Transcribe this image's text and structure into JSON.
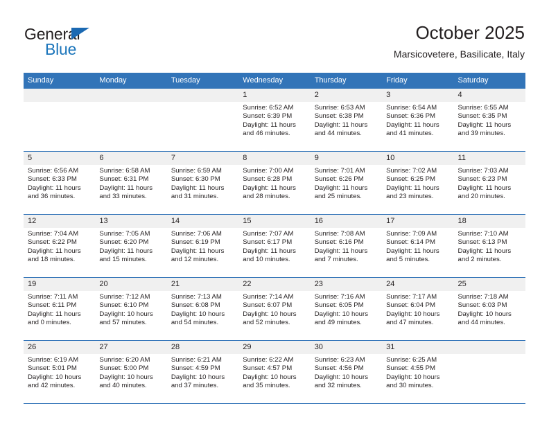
{
  "brand": {
    "name_top": "General",
    "name_bottom": "Blue",
    "accent_color": "#1b75bb",
    "triangle_color": "#1b69b2"
  },
  "header": {
    "title": "October 2025",
    "subtitle": "Marsicovetere, Basilicate, Italy"
  },
  "theme": {
    "header_row_bg": "#3274b8",
    "header_row_text": "#ffffff",
    "daynum_bg": "#f0f0f0",
    "body_text": "#231f20",
    "page_bg": "#ffffff"
  },
  "weekday_headers": [
    "Sunday",
    "Monday",
    "Tuesday",
    "Wednesday",
    "Thursday",
    "Friday",
    "Saturday"
  ],
  "labels": {
    "sunrise_prefix": "Sunrise:",
    "sunset_prefix": "Sunset:",
    "daylight_prefix": "Daylight:"
  },
  "weeks": [
    [
      {
        "day": "",
        "sunrise": "",
        "sunset": "",
        "daylight_line1": "",
        "daylight_line2": "",
        "empty": true
      },
      {
        "day": "",
        "sunrise": "",
        "sunset": "",
        "daylight_line1": "",
        "daylight_line2": "",
        "empty": true
      },
      {
        "day": "",
        "sunrise": "",
        "sunset": "",
        "daylight_line1": "",
        "daylight_line2": "",
        "empty": true
      },
      {
        "day": "1",
        "sunrise": "Sunrise: 6:52 AM",
        "sunset": "Sunset: 6:39 PM",
        "daylight_line1": "Daylight: 11 hours",
        "daylight_line2": "and 46 minutes."
      },
      {
        "day": "2",
        "sunrise": "Sunrise: 6:53 AM",
        "sunset": "Sunset: 6:38 PM",
        "daylight_line1": "Daylight: 11 hours",
        "daylight_line2": "and 44 minutes."
      },
      {
        "day": "3",
        "sunrise": "Sunrise: 6:54 AM",
        "sunset": "Sunset: 6:36 PM",
        "daylight_line1": "Daylight: 11 hours",
        "daylight_line2": "and 41 minutes."
      },
      {
        "day": "4",
        "sunrise": "Sunrise: 6:55 AM",
        "sunset": "Sunset: 6:35 PM",
        "daylight_line1": "Daylight: 11 hours",
        "daylight_line2": "and 39 minutes."
      }
    ],
    [
      {
        "day": "5",
        "sunrise": "Sunrise: 6:56 AM",
        "sunset": "Sunset: 6:33 PM",
        "daylight_line1": "Daylight: 11 hours",
        "daylight_line2": "and 36 minutes."
      },
      {
        "day": "6",
        "sunrise": "Sunrise: 6:58 AM",
        "sunset": "Sunset: 6:31 PM",
        "daylight_line1": "Daylight: 11 hours",
        "daylight_line2": "and 33 minutes."
      },
      {
        "day": "7",
        "sunrise": "Sunrise: 6:59 AM",
        "sunset": "Sunset: 6:30 PM",
        "daylight_line1": "Daylight: 11 hours",
        "daylight_line2": "and 31 minutes."
      },
      {
        "day": "8",
        "sunrise": "Sunrise: 7:00 AM",
        "sunset": "Sunset: 6:28 PM",
        "daylight_line1": "Daylight: 11 hours",
        "daylight_line2": "and 28 minutes."
      },
      {
        "day": "9",
        "sunrise": "Sunrise: 7:01 AM",
        "sunset": "Sunset: 6:26 PM",
        "daylight_line1": "Daylight: 11 hours",
        "daylight_line2": "and 25 minutes."
      },
      {
        "day": "10",
        "sunrise": "Sunrise: 7:02 AM",
        "sunset": "Sunset: 6:25 PM",
        "daylight_line1": "Daylight: 11 hours",
        "daylight_line2": "and 23 minutes."
      },
      {
        "day": "11",
        "sunrise": "Sunrise: 7:03 AM",
        "sunset": "Sunset: 6:23 PM",
        "daylight_line1": "Daylight: 11 hours",
        "daylight_line2": "and 20 minutes."
      }
    ],
    [
      {
        "day": "12",
        "sunrise": "Sunrise: 7:04 AM",
        "sunset": "Sunset: 6:22 PM",
        "daylight_line1": "Daylight: 11 hours",
        "daylight_line2": "and 18 minutes."
      },
      {
        "day": "13",
        "sunrise": "Sunrise: 7:05 AM",
        "sunset": "Sunset: 6:20 PM",
        "daylight_line1": "Daylight: 11 hours",
        "daylight_line2": "and 15 minutes."
      },
      {
        "day": "14",
        "sunrise": "Sunrise: 7:06 AM",
        "sunset": "Sunset: 6:19 PM",
        "daylight_line1": "Daylight: 11 hours",
        "daylight_line2": "and 12 minutes."
      },
      {
        "day": "15",
        "sunrise": "Sunrise: 7:07 AM",
        "sunset": "Sunset: 6:17 PM",
        "daylight_line1": "Daylight: 11 hours",
        "daylight_line2": "and 10 minutes."
      },
      {
        "day": "16",
        "sunrise": "Sunrise: 7:08 AM",
        "sunset": "Sunset: 6:16 PM",
        "daylight_line1": "Daylight: 11 hours",
        "daylight_line2": "and 7 minutes."
      },
      {
        "day": "17",
        "sunrise": "Sunrise: 7:09 AM",
        "sunset": "Sunset: 6:14 PM",
        "daylight_line1": "Daylight: 11 hours",
        "daylight_line2": "and 5 minutes."
      },
      {
        "day": "18",
        "sunrise": "Sunrise: 7:10 AM",
        "sunset": "Sunset: 6:13 PM",
        "daylight_line1": "Daylight: 11 hours",
        "daylight_line2": "and 2 minutes."
      }
    ],
    [
      {
        "day": "19",
        "sunrise": "Sunrise: 7:11 AM",
        "sunset": "Sunset: 6:11 PM",
        "daylight_line1": "Daylight: 11 hours",
        "daylight_line2": "and 0 minutes."
      },
      {
        "day": "20",
        "sunrise": "Sunrise: 7:12 AM",
        "sunset": "Sunset: 6:10 PM",
        "daylight_line1": "Daylight: 10 hours",
        "daylight_line2": "and 57 minutes."
      },
      {
        "day": "21",
        "sunrise": "Sunrise: 7:13 AM",
        "sunset": "Sunset: 6:08 PM",
        "daylight_line1": "Daylight: 10 hours",
        "daylight_line2": "and 54 minutes."
      },
      {
        "day": "22",
        "sunrise": "Sunrise: 7:14 AM",
        "sunset": "Sunset: 6:07 PM",
        "daylight_line1": "Daylight: 10 hours",
        "daylight_line2": "and 52 minutes."
      },
      {
        "day": "23",
        "sunrise": "Sunrise: 7:16 AM",
        "sunset": "Sunset: 6:05 PM",
        "daylight_line1": "Daylight: 10 hours",
        "daylight_line2": "and 49 minutes."
      },
      {
        "day": "24",
        "sunrise": "Sunrise: 7:17 AM",
        "sunset": "Sunset: 6:04 PM",
        "daylight_line1": "Daylight: 10 hours",
        "daylight_line2": "and 47 minutes."
      },
      {
        "day": "25",
        "sunrise": "Sunrise: 7:18 AM",
        "sunset": "Sunset: 6:03 PM",
        "daylight_line1": "Daylight: 10 hours",
        "daylight_line2": "and 44 minutes."
      }
    ],
    [
      {
        "day": "26",
        "sunrise": "Sunrise: 6:19 AM",
        "sunset": "Sunset: 5:01 PM",
        "daylight_line1": "Daylight: 10 hours",
        "daylight_line2": "and 42 minutes."
      },
      {
        "day": "27",
        "sunrise": "Sunrise: 6:20 AM",
        "sunset": "Sunset: 5:00 PM",
        "daylight_line1": "Daylight: 10 hours",
        "daylight_line2": "and 40 minutes."
      },
      {
        "day": "28",
        "sunrise": "Sunrise: 6:21 AM",
        "sunset": "Sunset: 4:59 PM",
        "daylight_line1": "Daylight: 10 hours",
        "daylight_line2": "and 37 minutes."
      },
      {
        "day": "29",
        "sunrise": "Sunrise: 6:22 AM",
        "sunset": "Sunset: 4:57 PM",
        "daylight_line1": "Daylight: 10 hours",
        "daylight_line2": "and 35 minutes."
      },
      {
        "day": "30",
        "sunrise": "Sunrise: 6:23 AM",
        "sunset": "Sunset: 4:56 PM",
        "daylight_line1": "Daylight: 10 hours",
        "daylight_line2": "and 32 minutes."
      },
      {
        "day": "31",
        "sunrise": "Sunrise: 6:25 AM",
        "sunset": "Sunset: 4:55 PM",
        "daylight_line1": "Daylight: 10 hours",
        "daylight_line2": "and 30 minutes."
      },
      {
        "day": "",
        "sunrise": "",
        "sunset": "",
        "daylight_line1": "",
        "daylight_line2": "",
        "empty": true
      }
    ]
  ]
}
